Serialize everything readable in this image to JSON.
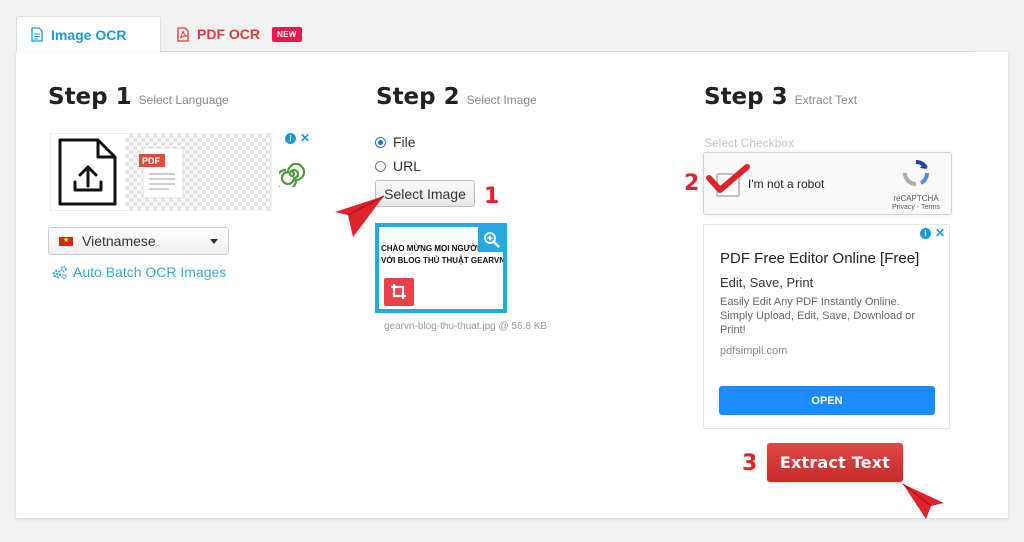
{
  "tabs": {
    "image_ocr": "Image OCR",
    "pdf_ocr": "PDF OCR",
    "new_badge": "NEW"
  },
  "step1": {
    "title": "Step 1",
    "subtitle": "Select Language",
    "language": "Vietnamese",
    "batch_link": "Auto Batch OCR Images",
    "ad_badge_text": "PDF"
  },
  "step2": {
    "title": "Step 2",
    "subtitle": "Select Image",
    "option_file": "File",
    "option_url": "URL",
    "select_button": "Select Image",
    "preview_text": "CHÀO MỪNG MỌI NGƯỜI ĐẾN VỚI BLOG THỦ THUẬT GEARVN",
    "file_info": "gearvn-blog-thu-thuat.jpg @ 56.8 KB"
  },
  "step3": {
    "title": "Step 3",
    "subtitle": "Extract Text",
    "checkbox_label": "Select Checkbox",
    "recaptcha": {
      "label": "I'm not a robot",
      "brand": "reCAPTCHA",
      "links": "Privacy - Terms"
    },
    "ad": {
      "title": "PDF Free Editor Online [Free]",
      "subtitle": "Edit, Save, Print",
      "body": "Easily Edit Any PDF Instantly Online. Simply Upload, Edit, Save, Download or Print!",
      "domain": "pdfsimpli.com",
      "cta": "OPEN"
    },
    "extract_button": "Extract Text"
  },
  "annotations": {
    "n1": "1",
    "n2": "2",
    "n3": "3"
  },
  "colors": {
    "tab_active": "#1a9ad9",
    "tab_pdf": "#e03a3a",
    "new_badge": "#e8194f",
    "extract_button": "#d63333",
    "ad_cta": "#1a8cff",
    "preview_border": "#26a9e0",
    "annotation": "#e0222a"
  }
}
